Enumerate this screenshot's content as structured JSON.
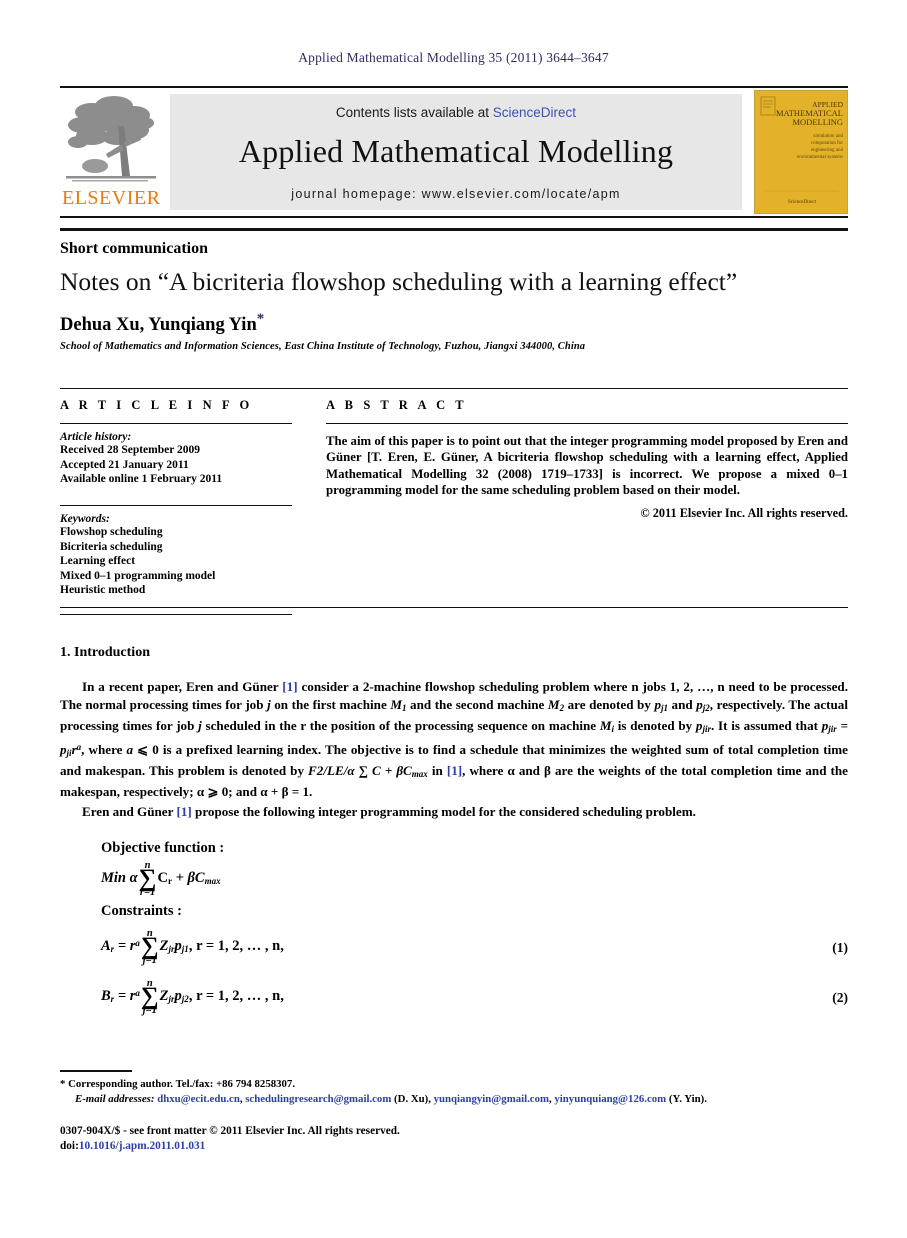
{
  "running_head": "Applied Mathematical Modelling 35 (2011) 3644–3647",
  "masthead": {
    "contents_prefix": "Contents lists available at",
    "sciencedirect": "ScienceDirect",
    "journal_title": "Applied Mathematical Modelling",
    "homepage": "journal homepage: www.elsevier.com/locate/apm",
    "publisher": "ELSEVIER",
    "cover_title_line1": "APPLIED",
    "cover_title_line2": "MATHEMATICAL",
    "cover_title_line3": "MODELLING",
    "cover_sub": "simulation and computation for engineering and environmental systems",
    "cover_footer": "ScienceDirect",
    "link_color": "#3a53b0",
    "elsevier_orange": "#e87b10",
    "cover_yellow": "#e3b228"
  },
  "doctype": "Short communication",
  "title": "Notes on “A bicriteria flowshop scheduling with a learning effect”",
  "authors": "Dehua Xu, Yunqiang Yin",
  "author_marker": "*",
  "affiliation": "School of Mathematics and Information Sciences, East China Institute of Technology, Fuzhou, Jiangxi 344000, China",
  "article_info": {
    "heading": "A R T I C L E   I N F O",
    "history_label": "Article history:",
    "history": [
      "Received 28 September 2009",
      "Accepted 21 January 2011",
      "Available online 1 February 2011"
    ],
    "keywords_label": "Keywords:",
    "keywords": [
      "Flowshop scheduling",
      "Bicriteria scheduling",
      "Learning effect",
      "Mixed 0–1 programming model",
      "Heuristic method"
    ]
  },
  "abstract": {
    "heading": "A B S T R A C T",
    "text": "The aim of this paper is to point out that the integer programming model proposed by Eren and Güner [T. Eren, E. Güner, A bicriteria flowshop scheduling with a learning effect, Applied Mathematical Modelling 32 (2008) 1719–1733] is incorrect. We propose a mixed 0–1 programming model for the same scheduling problem based on their model.",
    "copyright": "© 2011 Elsevier Inc. All rights reserved."
  },
  "section": {
    "number_title": "1. Introduction",
    "para1_a": "In a recent paper, Eren and Güner ",
    "para1_ref": "[1]",
    "para1_b": " consider a 2-machine flowshop scheduling problem where n jobs 1, 2, …, n need to be processed. The normal processing times for job ",
    "para1_c": " on the first machine ",
    "para1_d": " and the second machine ",
    "para1_e": " are denoted by ",
    "para1_f": " and ",
    "para1_g": ", respectively. The actual processing times for job ",
    "para1_h": " scheduled in the r the position of the processing sequence on machine ",
    "para1_i": " is denoted by ",
    "para1_j": ". It is assumed that ",
    "para1_k": ", where ",
    "para1_l": " ⩽ 0 is a prefixed learning index. The objective is to find a schedule that minimizes the weighted sum of total completion time and makespan. This problem is denoted by ",
    "para1_m": " in ",
    "para1_n": ", where α and β are the weights of the total completion time and the makespan, respectively; α ⩾ 0; and α + β = 1.",
    "para2_a": "Eren and Güner ",
    "para2_ref": "[1]",
    "para2_b": " propose the following integer programming model for the considered scheduling problem."
  },
  "math": {
    "objective_label": "Objective function",
    "constraints_label": "Constraints",
    "colon": ":",
    "obj_min": "Min α",
    "obj_sum_top": "n",
    "obj_sum_bot": "r=1",
    "obj_body": "C",
    "obj_sub": "r",
    "obj_tail": "+ βC",
    "obj_tail_sub": "max",
    "eq1_lhs": "A",
    "eq1_lhs_sub": "r",
    "eq1_eq": " = r",
    "eq1_sup": "a",
    "eq1_sum_top": "n",
    "eq1_sum_bot": "j=1",
    "eq1_term": "Z",
    "eq1_term_sub": "jr",
    "eq1_term2": "p",
    "eq1_term2_sub": "j1",
    "eq1_range": ",   r = 1, 2, … , n,",
    "eq1_number": "(1)",
    "eq2_lhs": "B",
    "eq2_lhs_sub": "r",
    "eq2_eq": " = r",
    "eq2_sup": "a",
    "eq2_sum_top": "n",
    "eq2_sum_bot": "j=1",
    "eq2_term": "Z",
    "eq2_term_sub": "jr",
    "eq2_term2": "p",
    "eq2_term2_sub": "j2",
    "eq2_range": ",   r = 1, 2, … , n,",
    "eq2_number": "(2)"
  },
  "footnotes": {
    "corresponding": "* Corresponding author. Tel./fax: +86 794 8258307.",
    "email_label": "E-mail addresses:",
    "email1": "dhxu@ecit.edu.cn",
    "email2": "schedulingresearch@gmail.com",
    "email_owner1": "(D. Xu),",
    "email3": "yunqiangyin@gmail.com",
    "email4": "yinyunquiang@126.com",
    "email_owner2": "(Y. Yin).",
    "issn_line": "0307-904X/$ - see front matter © 2011 Elsevier Inc. All rights reserved.",
    "doi_label": "doi:",
    "doi_value": "10.1016/j.apm.2011.01.031"
  }
}
